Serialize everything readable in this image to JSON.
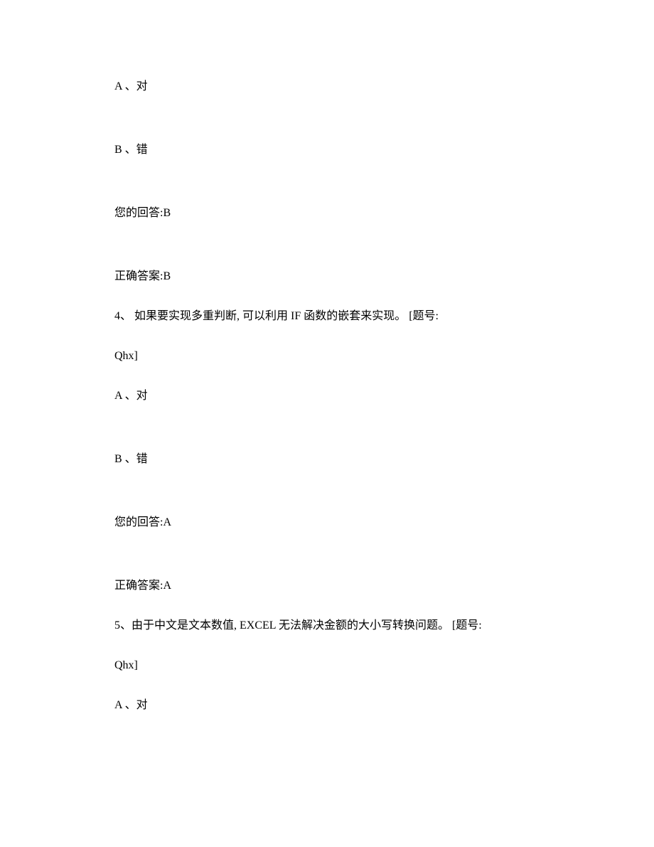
{
  "block1": {
    "optionA": "A 、对",
    "optionB": "B 、错",
    "yourAnswer": "您的回答:B",
    "correctAnswer": "正确答案:B"
  },
  "question4": {
    "textLine1": "4、 如果要实现多重判断, 可以利用 IF 函数的嵌套来实现。 [题号:",
    "textLine2": "Qhx]",
    "optionA": "A 、对",
    "optionB": "B 、错",
    "yourAnswer": "您的回答:A",
    "correctAnswer": "正确答案:A"
  },
  "question5": {
    "textLine1": "5、由于中文是文本数值, EXCEL 无法解决金额的大小写转换问题。 [题号:",
    "textLine2": "Qhx]",
    "optionA": "A 、对"
  }
}
